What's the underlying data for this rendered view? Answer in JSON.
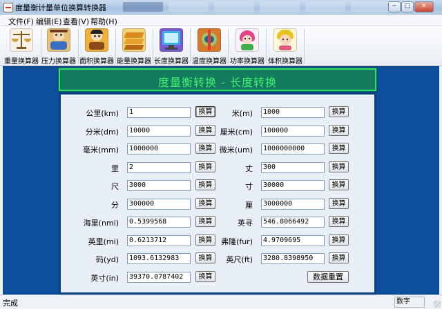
{
  "window": {
    "title": "度量衡计量单位换算转换器",
    "buttons": {
      "minimize": "─",
      "maximize": "□",
      "close": "✕"
    }
  },
  "menu": [
    "文件(F)",
    "编辑(E)",
    "查看(V)",
    "帮助(H)"
  ],
  "toolbar": [
    {
      "label": "重量换算器",
      "icon": "scale-icon"
    },
    {
      "label": "压力换算器",
      "icon": "pressure-icon"
    },
    {
      "label": "面积换算器",
      "icon": "area-icon"
    },
    {
      "label": "能量换算器",
      "icon": "energy-icon"
    },
    {
      "label": "长度换算器",
      "icon": "length-icon"
    },
    {
      "label": "温度换算器",
      "icon": "temperature-icon"
    },
    {
      "label": "功率换算器",
      "icon": "power-icon"
    },
    {
      "label": "体积换算器",
      "icon": "volume-icon"
    }
  ],
  "banner": "度量衡转换 - 长度转换",
  "convert_label": "换算",
  "reset_label": "数据重置",
  "fields": [
    {
      "label": "公里(km)",
      "value": "1"
    },
    {
      "label": "米(m)",
      "value": "1000"
    },
    {
      "label": "分米(dm)",
      "value": "10000"
    },
    {
      "label": "厘米(cm)",
      "value": "100000"
    },
    {
      "label": "毫米(mm)",
      "value": "1000000"
    },
    {
      "label": "微米(um)",
      "value": "1000000000"
    },
    {
      "label": "里",
      "value": "2"
    },
    {
      "label": "丈",
      "value": "300"
    },
    {
      "label": "尺",
      "value": "3000"
    },
    {
      "label": "寸",
      "value": "30000"
    },
    {
      "label": "分",
      "value": "300000"
    },
    {
      "label": "厘",
      "value": "3000000"
    },
    {
      "label": "海里(nmi)",
      "value": "0.5399568"
    },
    {
      "label": "英寻",
      "value": "546.8066492"
    },
    {
      "label": "英里(mi)",
      "value": "0.6213712"
    },
    {
      "label": "弗隆(fur)",
      "value": "4.9709695"
    },
    {
      "label": "码(yd)",
      "value": "1093.6132983"
    },
    {
      "label": "英尺(ft)",
      "value": "3280.8398950"
    },
    {
      "label": "英寸(in)",
      "value": "39370.0787402"
    }
  ],
  "status": {
    "left": "完成",
    "right": "数字"
  },
  "colors": {
    "client_bg": "#0d4f9c",
    "banner_bg": "#147a5e",
    "banner_text": "#3ff06e",
    "form_bg": "#e9eff7"
  }
}
